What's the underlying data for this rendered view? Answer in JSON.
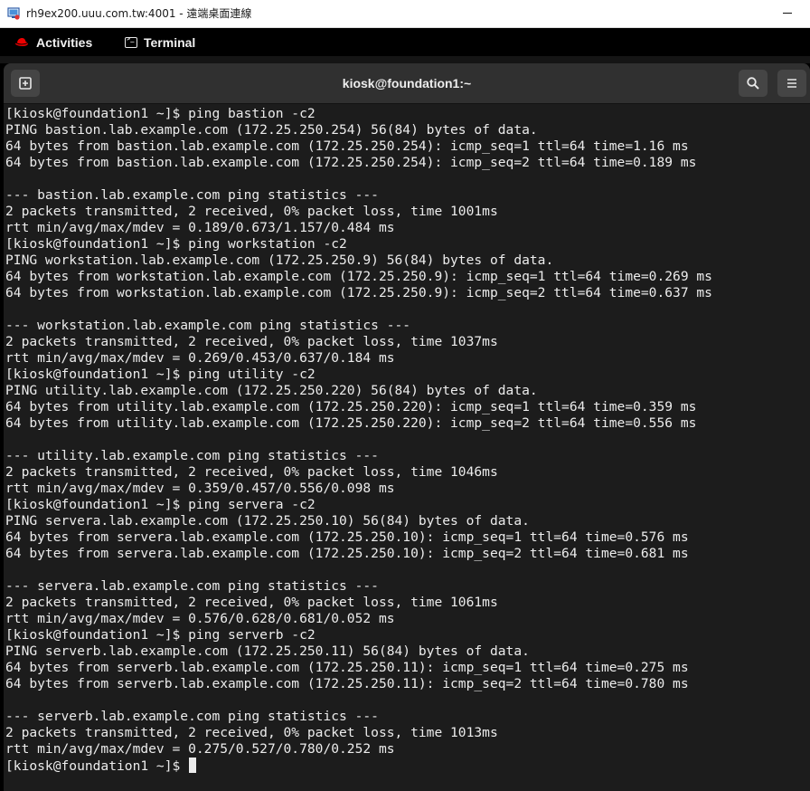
{
  "rdp_window": {
    "title": "rh9ex200.uuu.com.tw:4001 - 遠端桌面連線"
  },
  "gnome_topbar": {
    "activities_label": "Activities",
    "app_label": "Terminal"
  },
  "terminal_window": {
    "title": "kiosk@foundation1:~"
  },
  "terminal": {
    "lines": [
      "[kiosk@foundation1 ~]$ ping bastion -c2",
      "PING bastion.lab.example.com (172.25.250.254) 56(84) bytes of data.",
      "64 bytes from bastion.lab.example.com (172.25.250.254): icmp_seq=1 ttl=64 time=1.16 ms",
      "64 bytes from bastion.lab.example.com (172.25.250.254): icmp_seq=2 ttl=64 time=0.189 ms",
      "",
      "--- bastion.lab.example.com ping statistics ---",
      "2 packets transmitted, 2 received, 0% packet loss, time 1001ms",
      "rtt min/avg/max/mdev = 0.189/0.673/1.157/0.484 ms",
      "[kiosk@foundation1 ~]$ ping workstation -c2",
      "PING workstation.lab.example.com (172.25.250.9) 56(84) bytes of data.",
      "64 bytes from workstation.lab.example.com (172.25.250.9): icmp_seq=1 ttl=64 time=0.269 ms",
      "64 bytes from workstation.lab.example.com (172.25.250.9): icmp_seq=2 ttl=64 time=0.637 ms",
      "",
      "--- workstation.lab.example.com ping statistics ---",
      "2 packets transmitted, 2 received, 0% packet loss, time 1037ms",
      "rtt min/avg/max/mdev = 0.269/0.453/0.637/0.184 ms",
      "[kiosk@foundation1 ~]$ ping utility -c2",
      "PING utility.lab.example.com (172.25.250.220) 56(84) bytes of data.",
      "64 bytes from utility.lab.example.com (172.25.250.220): icmp_seq=1 ttl=64 time=0.359 ms",
      "64 bytes from utility.lab.example.com (172.25.250.220): icmp_seq=2 ttl=64 time=0.556 ms",
      "",
      "--- utility.lab.example.com ping statistics ---",
      "2 packets transmitted, 2 received, 0% packet loss, time 1046ms",
      "rtt min/avg/max/mdev = 0.359/0.457/0.556/0.098 ms",
      "[kiosk@foundation1 ~]$ ping servera -c2",
      "PING servera.lab.example.com (172.25.250.10) 56(84) bytes of data.",
      "64 bytes from servera.lab.example.com (172.25.250.10): icmp_seq=1 ttl=64 time=0.576 ms",
      "64 bytes from servera.lab.example.com (172.25.250.10): icmp_seq=2 ttl=64 time=0.681 ms",
      "",
      "--- servera.lab.example.com ping statistics ---",
      "2 packets transmitted, 2 received, 0% packet loss, time 1061ms",
      "rtt min/avg/max/mdev = 0.576/0.628/0.681/0.052 ms",
      "[kiosk@foundation1 ~]$ ping serverb -c2",
      "PING serverb.lab.example.com (172.25.250.11) 56(84) bytes of data.",
      "64 bytes from serverb.lab.example.com (172.25.250.11): icmp_seq=1 ttl=64 time=0.275 ms",
      "64 bytes from serverb.lab.example.com (172.25.250.11): icmp_seq=2 ttl=64 time=0.780 ms",
      "",
      "--- serverb.lab.example.com ping statistics ---",
      "2 packets transmitted, 2 received, 0% packet loss, time 1013ms",
      "rtt min/avg/max/mdev = 0.275/0.527/0.780/0.252 ms"
    ],
    "prompt": "[kiosk@foundation1 ~]$ "
  },
  "colors": {
    "terminal_bg": "#1c1c1c",
    "terminal_fg": "#ececec",
    "headerbar_bg": "#303030",
    "redhat_red": "#ee0000"
  },
  "icons": {
    "rdp": "remote-desktop-icon",
    "activities": "redhat-logo-icon",
    "app": "terminal-app-icon",
    "new_tab": "new-tab-icon",
    "search": "search-icon",
    "menu": "hamburger-menu-icon"
  }
}
